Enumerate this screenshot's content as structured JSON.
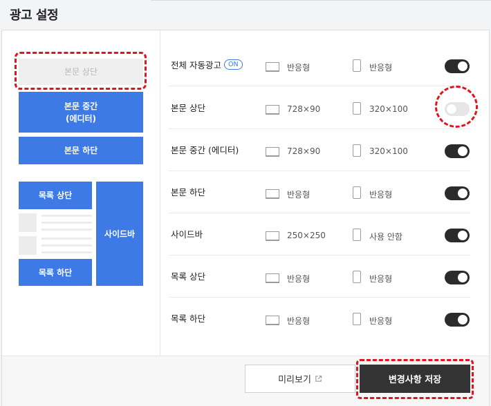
{
  "page": {
    "title": "광고 설정"
  },
  "preview": {
    "blocks": {
      "body_top": "본문 상단",
      "body_middle_line1": "본문 중간",
      "body_middle_line2": "(에디터)",
      "body_bottom": "본문 하단",
      "list_top": "목록 상단",
      "list_bottom": "목록 하단",
      "sidebar": "사이드바"
    }
  },
  "settings": {
    "rows": [
      {
        "label": "전체 자동광고",
        "badge": "ON",
        "pc": "반응형",
        "mobile": "반응형",
        "enabled": true
      },
      {
        "label": "본문 상단",
        "pc": "728×90",
        "mobile": "320×100",
        "enabled": false
      },
      {
        "label": "본문 중간 (에디터)",
        "pc": "728×90",
        "mobile": "320×100",
        "enabled": true
      },
      {
        "label": "본문 하단",
        "pc": "반응형",
        "mobile": "반응형",
        "enabled": true
      },
      {
        "label": "사이드바",
        "pc": "250×250",
        "mobile": "사용 안함",
        "enabled": true
      },
      {
        "label": "목록 상단",
        "pc": "반응형",
        "mobile": "반응형",
        "enabled": true
      },
      {
        "label": "목록 하단",
        "pc": "반응형",
        "mobile": "반응형",
        "enabled": true
      }
    ]
  },
  "footer": {
    "preview_label": "미리보기",
    "save_label": "변경사항 저장"
  },
  "colors": {
    "accent_blue": "#3d7ae6",
    "toggle_on": "#2b2b2b",
    "toggle_off": "#e6e6e6",
    "annotation_red": "#e0141e"
  },
  "icons": {
    "pc": "monitor-icon",
    "mobile": "phone-icon",
    "external": "external-link-icon"
  }
}
